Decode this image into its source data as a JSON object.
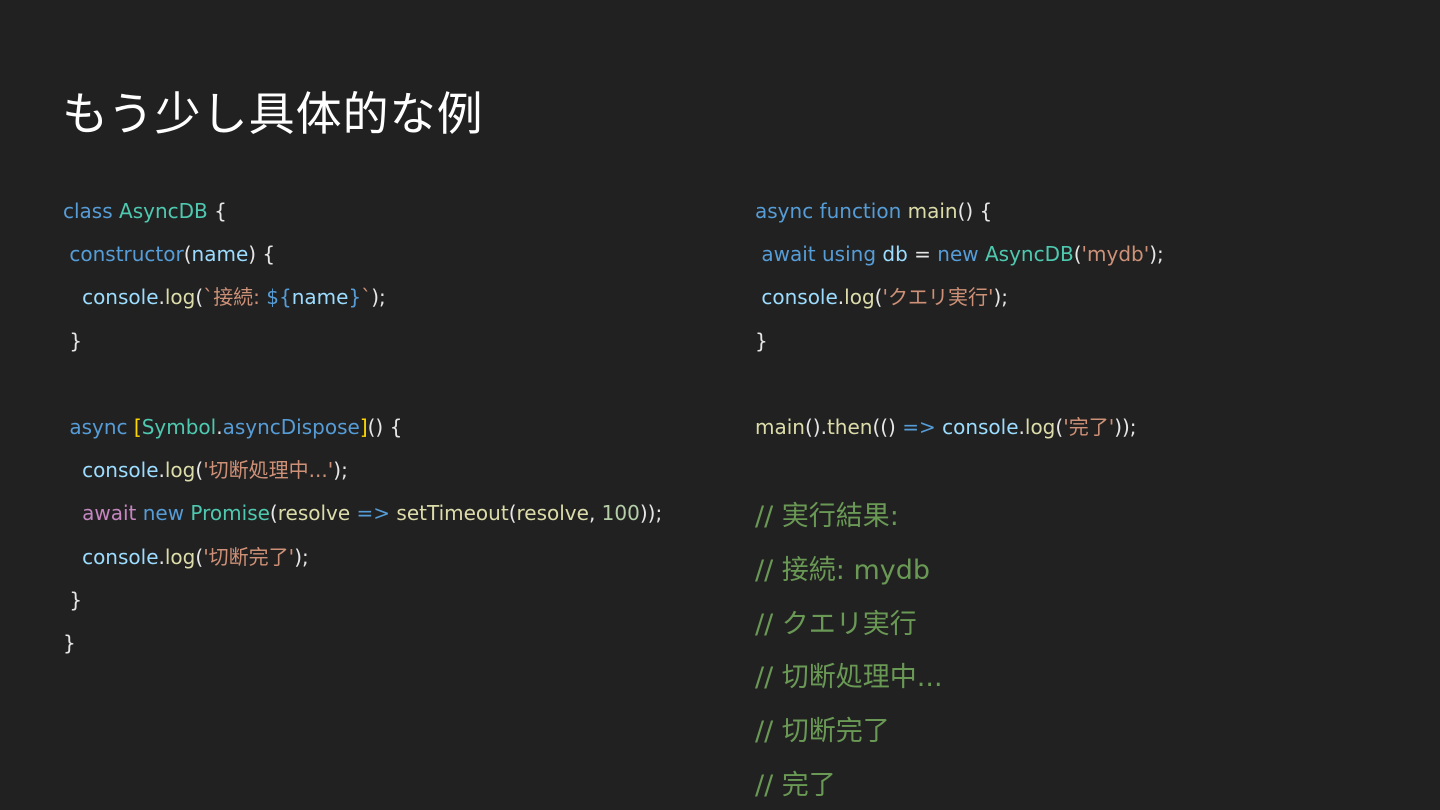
{
  "slide": {
    "title": "もう少し具体的な例"
  },
  "code_left": {
    "l1": {
      "t1": "class",
      "t2": " ",
      "t3": "AsyncDB",
      "t4": " {"
    },
    "l2": {
      "t0": " ",
      "t1": "constructor",
      "t2": "(",
      "t3": "name",
      "t4": ") {"
    },
    "l3": {
      "t0": "   ",
      "t1": "console",
      "t2": ".",
      "t3": "log",
      "t4": "(",
      "t5": "`接続: ",
      "t6": "${",
      "t7": "name",
      "t8": "}",
      "t9": "`",
      "t10": ");"
    },
    "l4": {
      "t0": " }"
    },
    "l5": {
      "t0": ""
    },
    "l6": {
      "t0": " ",
      "t1": "async",
      "t2": " ",
      "t3": "[",
      "t4": "Symbol",
      "t5": ".",
      "t6": "asyncDispose",
      "t7": "]",
      "t8": "() {"
    },
    "l7": {
      "t0": "   ",
      "t1": "console",
      "t2": ".",
      "t3": "log",
      "t4": "(",
      "t5": "'切断処理中...'",
      "t6": ");"
    },
    "l8": {
      "t0": "   ",
      "t1": "await",
      "t2": " ",
      "t3": "new",
      "t4": " ",
      "t5": "Promise",
      "t6": "(",
      "t7": "resolve",
      "t8": " ",
      "t9": "=>",
      "t10": " ",
      "t11": "setTimeout",
      "t12": "(",
      "t13": "resolve",
      "t14": ", ",
      "t15": "100",
      "t16": "));"
    },
    "l9": {
      "t0": "   ",
      "t1": "console",
      "t2": ".",
      "t3": "log",
      "t4": "(",
      "t5": "'切断完了'",
      "t6": ");"
    },
    "l10": {
      "t0": " }"
    },
    "l11": {
      "t0": "}"
    }
  },
  "code_right": {
    "l1": {
      "t1": "async",
      "t2": " ",
      "t3": "function",
      "t4": " ",
      "t5": "main",
      "t6": "() {"
    },
    "l2": {
      "t0": " ",
      "t1": "await",
      "t2": " ",
      "t3": "using",
      "t4": " ",
      "t5": "db",
      "t6": " = ",
      "t7": "new",
      "t8": " ",
      "t9": "AsyncDB",
      "t10": "(",
      "t11": "'mydb'",
      "t12": ");"
    },
    "l3": {
      "t0": " ",
      "t1": "console",
      "t2": ".",
      "t3": "log",
      "t4": "(",
      "t5": "'クエリ実行'",
      "t6": ");"
    },
    "l4": {
      "t0": "}"
    },
    "l5": {
      "t0": ""
    },
    "l6": {
      "t1": "main",
      "t2": "().",
      "t3": "then",
      "t4": "(() ",
      "t5": "=>",
      "t6": " ",
      "t7": "console",
      "t8": ".",
      "t9": "log",
      "t10": "(",
      "t11": "'完了'",
      "t12": "));"
    }
  },
  "result": {
    "lines": [
      "// 実行結果:",
      "// 接続: mydb",
      "// クエリ実行",
      "// 切断処理中...",
      "// 切断完了",
      "// 完了"
    ]
  },
  "colors": {
    "background": "#212121",
    "keyword": "#569cd6",
    "control": "#c586c0",
    "class": "#4ec9b0",
    "function": "#dcdcaa",
    "variable": "#9cdcfe",
    "string": "#ce9178",
    "number": "#b5cea8",
    "comment": "#6a9955",
    "text": "#e6e6e6"
  }
}
